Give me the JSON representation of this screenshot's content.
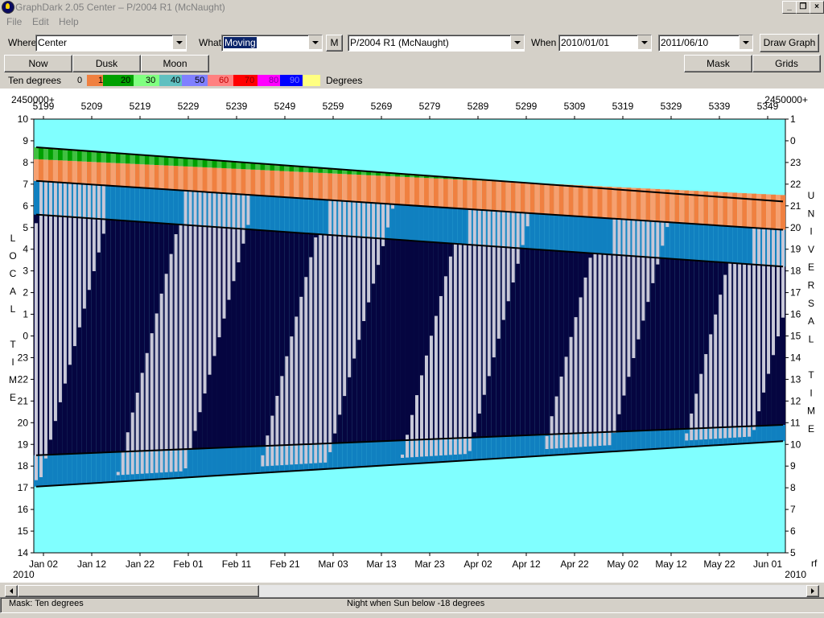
{
  "window": {
    "title": "GraphDark 2.05  Center  –  P/2004 R1 (McNaught)",
    "menu": [
      "File",
      "Edit",
      "Help"
    ]
  },
  "toolbar": {
    "where_label": "Where",
    "where_value": "Center",
    "what_label": "What",
    "what_value": "Moving",
    "m_button": "M",
    "object_value": "P/2004 R1 (McNaught)",
    "when_label": "When",
    "when_from": "2010/01/01",
    "when_to": "2011/06/10",
    "draw_button": "Draw Graph"
  },
  "buttons": {
    "now": "Now",
    "dusk": "Dusk",
    "moon": "Moon",
    "mask": "Mask",
    "grids": "Grids"
  },
  "legend": {
    "title": "Ten degrees",
    "items": [
      {
        "label": "0",
        "color": "#d4d0c8"
      },
      {
        "label": "10",
        "color": "#f08040"
      },
      {
        "label": "20",
        "color": "#00a000"
      },
      {
        "label": "30",
        "color": "#80ff80"
      },
      {
        "label": "40",
        "color": "#60c0c0"
      },
      {
        "label": "50",
        "color": "#8080ff"
      },
      {
        "label": "60",
        "color": "#ff8080"
      },
      {
        "label": "70",
        "color": "#ff0000"
      },
      {
        "label": "80",
        "color": "#ff00ff"
      },
      {
        "label": "90",
        "color": "#0000ff"
      },
      {
        "label": "",
        "color": "#ffff80"
      }
    ],
    "units": "Degrees"
  },
  "status": {
    "left": "Mask:  Ten degrees",
    "center": "Night when Sun below -18 degrees"
  },
  "chart_data": {
    "type": "heatmap",
    "colors": {
      "day": "#80ffff",
      "night": "#050540",
      "twilight": "#1080c0",
      "moon": "#c8c8d8",
      "obj10": "#f08040",
      "obj20": "#00a000",
      "obj20light": "#40c040",
      "obj30": "#80ff80",
      "obj40": "#9adada"
    },
    "top_left_label": "2450000+",
    "top_right_label": "2450000+",
    "jd_ticks": [
      "5199",
      "5209",
      "5219",
      "5229",
      "5239",
      "5249",
      "5259",
      "5269",
      "5279",
      "5289",
      "5299",
      "5309",
      "5319",
      "5329",
      "5339",
      "5349"
    ],
    "x_ticks": [
      "Jan 02",
      "Jan 12",
      "Jan 22",
      "Feb 01",
      "Feb 11",
      "Feb 21",
      "Mar 03",
      "Mar 13",
      "Mar 23",
      "Apr 02",
      "Apr 12",
      "Apr 22",
      "May 02",
      "May 12",
      "May 22",
      "Jun 01"
    ],
    "year_left": "2010",
    "year_right": "2010",
    "bottom_right_mark": "rf",
    "y_left_ticks": [
      "10",
      "9",
      "8",
      "7",
      "6",
      "5",
      "4",
      "3",
      "2",
      "1",
      "0",
      "23",
      "22",
      "21",
      "20",
      "19",
      "18",
      "17",
      "16",
      "15",
      "14"
    ],
    "y_right_ticks": [
      "1",
      "0",
      "23",
      "22",
      "21",
      "20",
      "19",
      "18",
      "17",
      "16",
      "15",
      "14",
      "13",
      "12",
      "11",
      "10",
      "9",
      "8",
      "7",
      "6",
      "5"
    ],
    "y_left_title": [
      "L",
      "O",
      "C",
      "A",
      "L",
      "",
      "T",
      "I",
      "M",
      "E"
    ],
    "y_right_title": [
      "U",
      "N",
      "I",
      "V",
      "E",
      "R",
      "S",
      "A",
      "L",
      "",
      "T",
      "I",
      "M",
      "E"
    ],
    "x_range_jd": [
      2455198.5,
      2455354.5
    ],
    "y_range_local_hours": [
      14,
      34
    ],
    "series": {
      "evening_twilight_end": {
        "jd": [
          2455199,
          2455354
        ],
        "hour": [
          18.5,
          19.9
        ]
      },
      "sunset": {
        "jd": [
          2455199,
          2455354
        ],
        "hour": [
          17.05,
          19.15
        ]
      },
      "morning_twilight_start": {
        "jd": [
          2455199,
          2455354
        ],
        "hour": [
          29.6,
          27.2
        ]
      },
      "object_set": {
        "jd": [
          2455199,
          2455354
        ],
        "hour": [
          31.15,
          28.9
        ]
      },
      "moon_full_jd": [
        2455199.5,
        2455229.5,
        2455259.1,
        2455288.5,
        2455318.0,
        2455347.3
      ]
    }
  }
}
